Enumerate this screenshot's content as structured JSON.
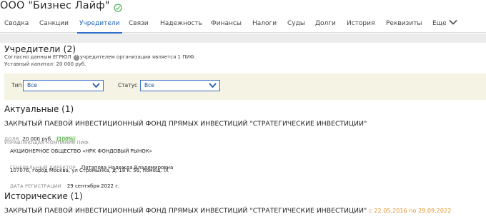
{
  "company": {
    "name": "ООО \"Бизнес Лайф\""
  },
  "tabs": [
    {
      "label": "Сводка"
    },
    {
      "label": "Санкции"
    },
    {
      "label": "Учредители"
    },
    {
      "label": "Связи"
    },
    {
      "label": "Надежность"
    },
    {
      "label": "Финансы"
    },
    {
      "label": "Налоги"
    },
    {
      "label": "Суды"
    },
    {
      "label": "Долги"
    },
    {
      "label": "История"
    },
    {
      "label": "Реквизиты"
    },
    {
      "label": "Еще"
    }
  ],
  "colors": {
    "accent": "#2d6ec6",
    "ok_green": "#4caf50",
    "filter_bg": "#f4f3e4",
    "date_orange": "#e0932a"
  },
  "founders": {
    "heading": "Учредители (2)",
    "egrul_line_before": "Согласно данным ЕГРЮЛ",
    "egrul_line_after": "учредителем организации является 1 ПИФ.",
    "capital": "Уставный капитал: 20 000 руб."
  },
  "filters": {
    "type_label": "Тип",
    "type_value": "Все",
    "status_label": "Статус",
    "status_value": "Все"
  },
  "current": {
    "heading": "Актуальные (1)",
    "fund_name": "ЗАКРЫТЫЙ ПАЕВОЙ ИНВЕСТИЦИОННЫЙ ФОНД ПРЯМЫХ ИНВЕСТИЦИЙ \"СТРАТЕГИЧЕСКИЕ ИНВЕСТИЦИИ\"",
    "share_label": "ДОЛЯ",
    "share_value": "20 000 руб.",
    "share_percent": "(100%)",
    "mgmt_label": "УПРАВЛЯЮЩАЯ КОМПАНИЯ ПИФ:",
    "mgmt_company": "АКЦИОНЕРНОЕ ОБЩЕСТВО «НРК ФОНДОВЫЙ РЫНОК»",
    "director_label": "ГЕНЕРАЛЬНЫЙ ДИРЕКТОР",
    "director_name": "Потапова Надежда Владимировна",
    "address": "107076, город Москва, ул Стромынка, д. 18 к. 56, помещ. IX",
    "reg_label": "ДАТА РЕГИСТРАЦИИ",
    "reg_date": "29 сентября 2022 г."
  },
  "historic": {
    "heading": "Исторические (1)",
    "fund_name": "ЗАКРЫТЫЙ ПАЕВОЙ ИНВЕСТИЦИОННЫЙ ФОНД ПРЯМЫХ ИНВЕСТИЦИЙ \"СТРАТЕГИЧЕСКИЕ ИНВЕСТИЦИИ\"",
    "period": "с 22.05.2016 по 29.09.2022"
  }
}
